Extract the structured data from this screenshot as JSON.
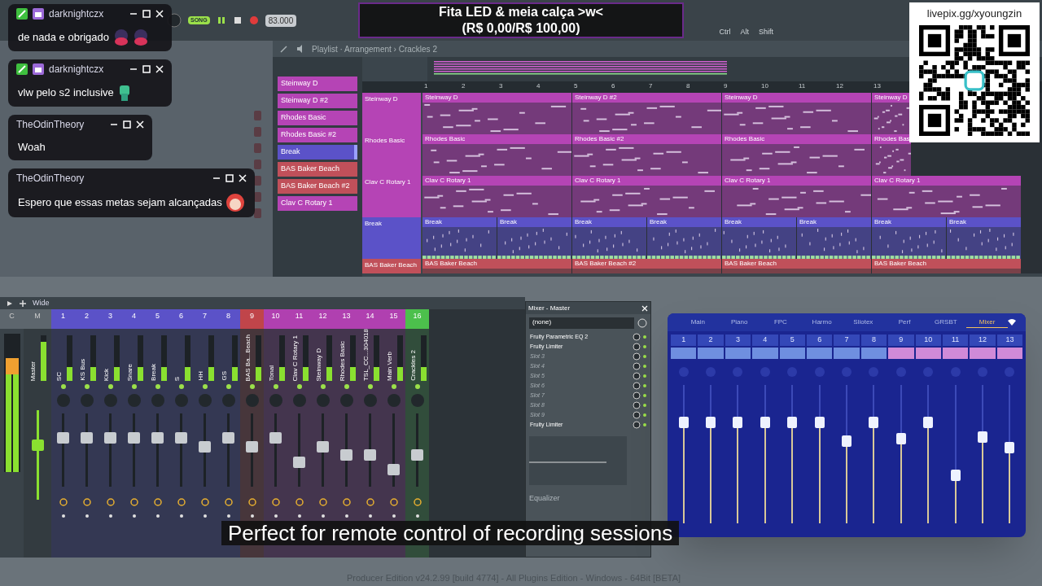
{
  "toolbar": {
    "mode": "SONG",
    "tempo": "83.000",
    "keys": [
      "Ctrl",
      "Alt",
      "Shift"
    ]
  },
  "goal": {
    "title": "Fita LED & meia calça >w<",
    "amount": "(R$ 0,00/R$ 100,00)"
  },
  "donation": {
    "url": "livepix.gg/xyoungzin"
  },
  "chat": [
    {
      "user": "darknightczx",
      "badges": true,
      "message": "de nada e obrigado",
      "kind": "pair"
    },
    {
      "user": "darknightczx",
      "badges": true,
      "message": "vlw pelo s2 inclusive",
      "kind": "single"
    },
    {
      "user": "TheOdinTheory",
      "badges": false,
      "message": "Woah",
      "kind": "plain"
    },
    {
      "user": "TheOdinTheory",
      "badges": false,
      "message": "Espero que essas metas sejam alcançadas",
      "kind": "face"
    }
  ],
  "playlist": {
    "title": "Playlist · Arrangement › Crackles 2",
    "patterns": [
      {
        "label": "Steinway D",
        "color": "#b544b5",
        "selected": false
      },
      {
        "label": "Steinway D #2",
        "color": "#b544b5",
        "selected": false
      },
      {
        "label": "Rhodes Basic",
        "color": "#b544b5",
        "selected": false
      },
      {
        "label": "Rhodes Basic #2",
        "color": "#b544b5",
        "selected": false
      },
      {
        "label": "Break",
        "color": "#5b52c8",
        "selected": true
      },
      {
        "label": "BAS Baker Beach",
        "color": "#c0505a",
        "selected": false
      },
      {
        "label": "BAS Baker Beach #2",
        "color": "#c0505a",
        "selected": false
      },
      {
        "label": "Clav C Rotary 1",
        "color": "#b544b5",
        "selected": false
      }
    ],
    "bars": [
      "1",
      "2",
      "3",
      "4",
      "5",
      "6",
      "7",
      "8",
      "9",
      "10",
      "11",
      "12",
      "13"
    ],
    "tracks": [
      {
        "name": "Steinway D",
        "color": "#b544b5",
        "clips": [
          "Steinway D",
          "Steinway D #2",
          "Steinway D",
          "Steinway D"
        ]
      },
      {
        "name": "Rhodes Basic",
        "color": "#b544b5",
        "clips": [
          "Rhodes Basic",
          "Rhodes Basic #2",
          "Rhodes Basic",
          "Rhodes Bas"
        ]
      },
      {
        "name": "Clav C Rotary 1",
        "color": "#b544b5",
        "clips": [
          "Clav C Rotary 1",
          "Clav C Rotary 1",
          "Clav C Rotary 1",
          "Clav C Rotary 1"
        ]
      },
      {
        "name": "Break",
        "color": "#5b52c8",
        "clips": [
          "Break",
          "Break",
          "Break",
          "Break",
          "Break",
          "Break",
          "Break",
          "Break"
        ]
      },
      {
        "name": "BAS Baker Beach",
        "color": "#c0505a",
        "clips": [
          "BAS Baker Beach",
          "BAS Baker Beach #2",
          "BAS Baker Beach",
          "BAS Baker Beach"
        ]
      }
    ]
  },
  "mixer": {
    "preset": "Wide",
    "current": "C",
    "master": {
      "label": "M",
      "name": "Master",
      "level": 0.62
    },
    "inserts": [
      {
        "number": "1",
        "name": "SC",
        "color": "#5b52c8",
        "level": 0.7
      },
      {
        "number": "2",
        "name": "KS Bus",
        "color": "#5b52c8",
        "level": 0.7
      },
      {
        "number": "3",
        "name": "Kick",
        "color": "#5b52c8",
        "level": 0.7
      },
      {
        "number": "4",
        "name": "Snare",
        "color": "#5b52c8",
        "level": 0.7
      },
      {
        "number": "5",
        "name": "Break",
        "color": "#5b52c8",
        "level": 0.7
      },
      {
        "number": "6",
        "name": "S",
        "color": "#5b52c8",
        "level": 0.7
      },
      {
        "number": "7",
        "name": "HH",
        "color": "#5b52c8",
        "level": 0.55
      },
      {
        "number": "8",
        "name": "GS",
        "color": "#5b52c8",
        "level": 0.7
      },
      {
        "number": "9",
        "name": "BAS Ba...Beach",
        "color": "#c0454a",
        "level": 0.55
      },
      {
        "number": "10",
        "name": "Tonal",
        "color": "#b040b0",
        "level": 0.7
      },
      {
        "number": "11",
        "name": "Clav C Rotary 1",
        "color": "#b040b0",
        "level": 0.3
      },
      {
        "number": "12",
        "name": "Steinway D",
        "color": "#b040b0",
        "level": 0.55
      },
      {
        "number": "13",
        "name": "Rhodes Basic",
        "color": "#b040b0",
        "level": 0.42
      },
      {
        "number": "14",
        "name": "TSL_CC...304018",
        "color": "#b040b0",
        "level": 0.42
      },
      {
        "number": "15",
        "name": "Main Verb",
        "color": "#b040b0",
        "level": 0.18
      },
      {
        "number": "16",
        "name": "Crackles 2",
        "color": "#4cc04c",
        "level": 0.42
      }
    ]
  },
  "mixer_panel": {
    "title": "Mixer - Master",
    "input": "(none)",
    "section": "Equalizer",
    "slots": [
      {
        "label": "Fruity Parametric EQ 2",
        "disabled": false
      },
      {
        "label": "Fruity Limiter",
        "disabled": false
      },
      {
        "label": "Slot 3",
        "disabled": true
      },
      {
        "label": "Slot 4",
        "disabled": true
      },
      {
        "label": "Slot 5",
        "disabled": true
      },
      {
        "label": "Slot 6",
        "disabled": true
      },
      {
        "label": "Slot 7",
        "disabled": true
      },
      {
        "label": "Slot 8",
        "disabled": true
      },
      {
        "label": "Slot 9",
        "disabled": true
      },
      {
        "label": "Fruity Limiter",
        "disabled": false
      }
    ]
  },
  "remote": {
    "tabs": [
      {
        "label": "Main",
        "selected": false
      },
      {
        "label": "Piano",
        "selected": false
      },
      {
        "label": "FPC",
        "selected": false
      },
      {
        "label": "Harmo",
        "selected": false
      },
      {
        "label": "Sliotex",
        "selected": false
      },
      {
        "label": "Perf",
        "selected": false
      },
      {
        "label": "GRSBT",
        "selected": false
      },
      {
        "label": "Mixer",
        "selected": true
      }
    ],
    "faders": [
      {
        "number": "1",
        "color": "#6f8fe0",
        "level": 0.75
      },
      {
        "number": "2",
        "color": "#6f8fe0",
        "level": 0.75
      },
      {
        "number": "3",
        "color": "#6f8fe0",
        "level": 0.75
      },
      {
        "number": "4",
        "color": "#6f8fe0",
        "level": 0.75
      },
      {
        "number": "5",
        "color": "#6f8fe0",
        "level": 0.75
      },
      {
        "number": "6",
        "color": "#6f8fe0",
        "level": 0.75
      },
      {
        "number": "7",
        "color": "#6f8fe0",
        "level": 0.6
      },
      {
        "number": "8",
        "color": "#6f8fe0",
        "level": 0.75
      },
      {
        "number": "9",
        "color": "#d08ad8",
        "level": 0.62
      },
      {
        "number": "10",
        "color": "#d08ad8",
        "level": 0.75
      },
      {
        "number": "11",
        "color": "#d08ad8",
        "level": 0.33
      },
      {
        "number": "12",
        "color": "#d08ad8",
        "level": 0.63
      },
      {
        "number": "13",
        "color": "#d08ad8",
        "level": 0.55
      }
    ]
  },
  "subtitle": "Perfect for remote control of recording sessions",
  "status": "Producer Edition v24.2.99 [build 4774] - All Plugins Edition - Windows - 64Bit [BETA]"
}
